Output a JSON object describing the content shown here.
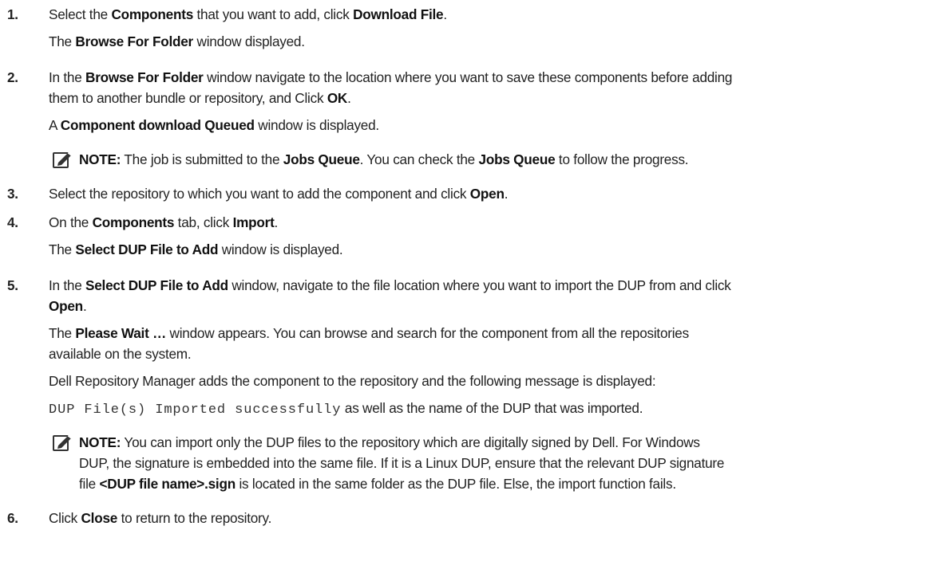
{
  "steps": [
    {
      "num": "1.",
      "line1": [
        "Select the ",
        "Components",
        " that you want to add, click ",
        "Download File",
        "."
      ],
      "line2": [
        "The ",
        "Browse For Folder",
        " window displayed."
      ]
    },
    {
      "num": "2.",
      "line1": [
        "In the ",
        "Browse For Folder",
        " window navigate to the location where you want to save these components before adding"
      ],
      "line1b": [
        "them to another bundle or repository, and Click ",
        "OK",
        "."
      ],
      "line2": [
        "A ",
        "Component download Queued",
        " window is displayed."
      ],
      "note": [
        "NOTE:",
        " The job is submitted to the ",
        "Jobs Queue",
        ". You can check the ",
        "Jobs Queue",
        " to follow the progress."
      ]
    },
    {
      "num": "3.",
      "line1": [
        "Select the repository to which you want to add the component and click ",
        "Open",
        "."
      ]
    },
    {
      "num": "4.",
      "line1": [
        "On the ",
        "Components",
        " tab, click ",
        "Import",
        "."
      ],
      "line2": [
        "The ",
        "Select DUP File to Add",
        " window is displayed."
      ]
    },
    {
      "num": "5.",
      "line1": [
        "In the ",
        "Select DUP File to Add",
        " window, navigate to the file location where you want to import the DUP from and click"
      ],
      "line1b": [
        "Open",
        "."
      ],
      "line2": [
        "The ",
        "Please Wait …",
        " window appears. You can browse and search for the component from all the repositories"
      ],
      "line2b": "available on the system.",
      "line3": "Dell Repository Manager adds the component to the repository and the following message is displayed:",
      "line4_mono": "DUP File(s) Imported successfully",
      "line4_rest": " as well as the name of the DUP that was imported.",
      "note": {
        "l1": [
          "NOTE:",
          " You can import only the DUP files to the repository which are digitally signed by Dell. For Windows"
        ],
        "l2": "DUP, the signature is embedded into the same file. If it is a Linux DUP, ensure that the relevant DUP signature",
        "l3": [
          "file ",
          "<DUP file name>.sign",
          " is located in the same folder as the DUP file. Else, the import function fails."
        ]
      }
    },
    {
      "num": "6.",
      "line1": [
        "Click ",
        "Close",
        " to return to the repository."
      ]
    }
  ],
  "icons": {
    "note": "pencil-note-icon"
  }
}
